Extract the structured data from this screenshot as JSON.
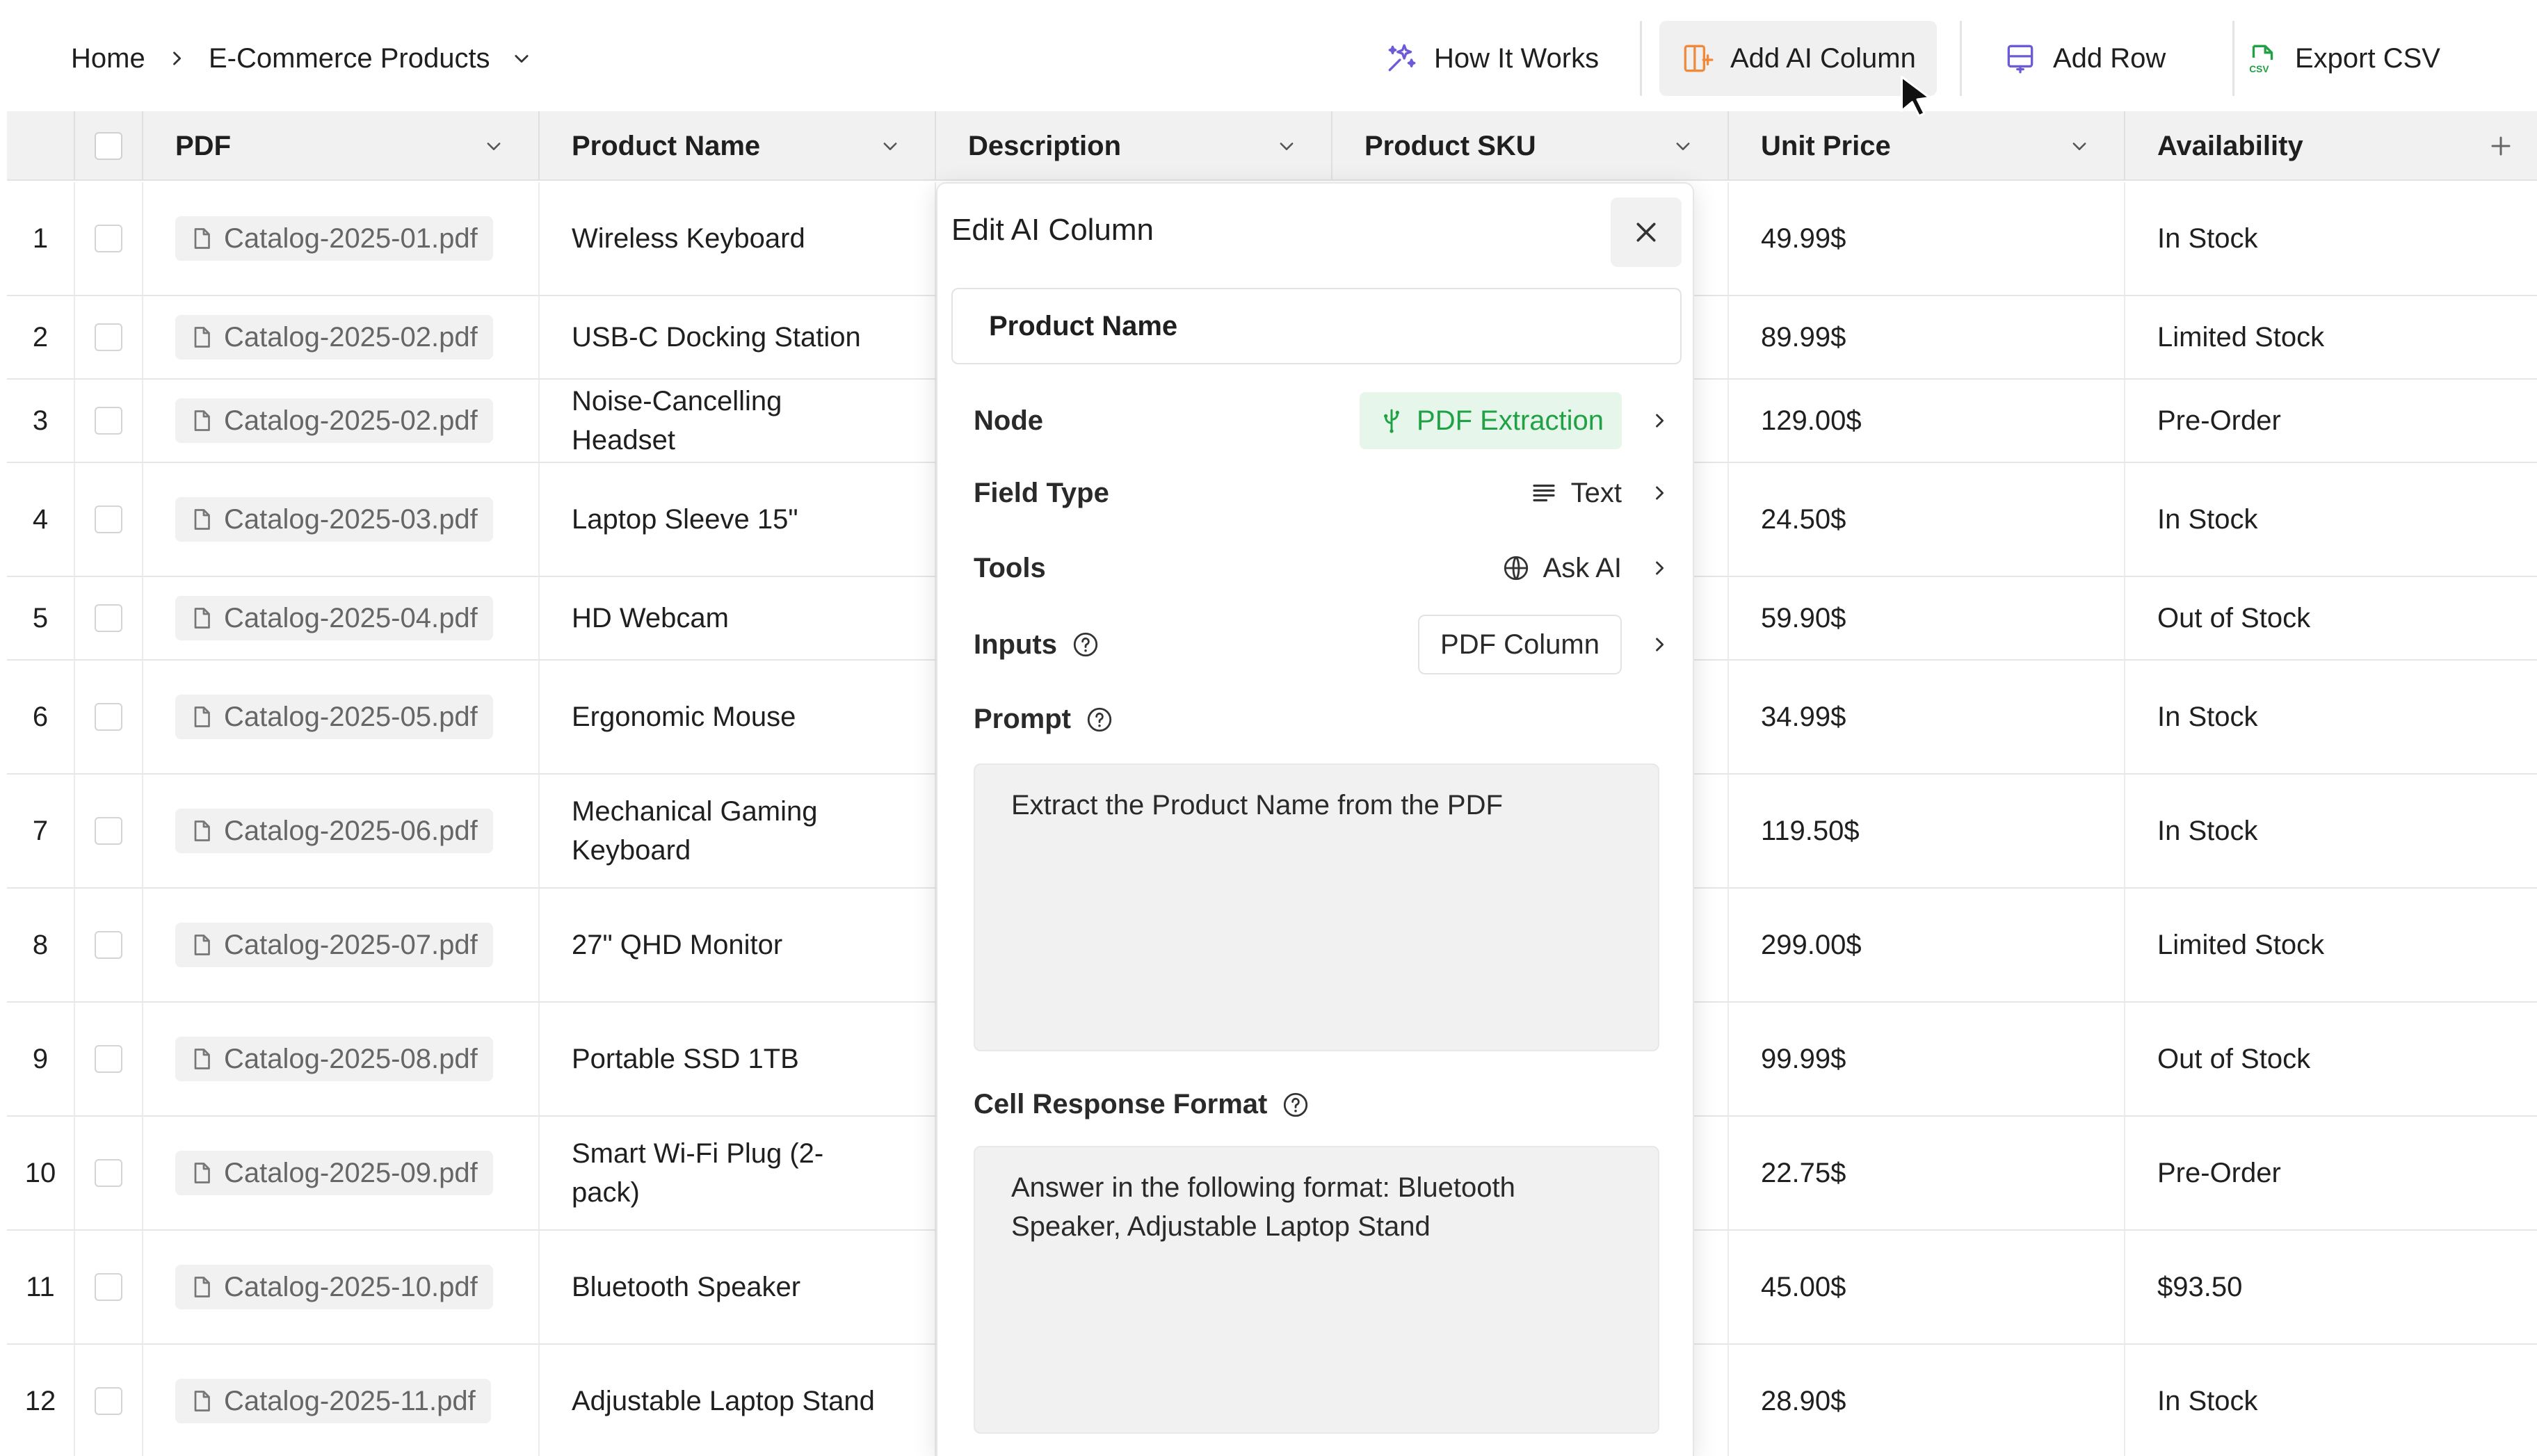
{
  "breadcrumb": {
    "home": "Home",
    "page": "E-Commerce Products"
  },
  "toolbar": {
    "how_it_works": "How It Works",
    "add_ai_column": "Add AI Column",
    "add_row": "Add Row",
    "export_csv": "Export CSV"
  },
  "colors": {
    "accent_green": "#21a146",
    "green_bg": "#e6f6ea",
    "purple_icon": "#6b5bd6",
    "orange_icon": "#ef8a3c",
    "header_bg": "#f1f1f1"
  },
  "table": {
    "columns": [
      "PDF",
      "Product Name",
      "Description",
      "Product SKU",
      "Unit Price",
      "Availability"
    ],
    "rows": [
      {
        "num": "1",
        "pdf": "Catalog-2025-01.pdf",
        "name": "Wireless Keyboard",
        "price": "49.99$",
        "availability": "In Stock"
      },
      {
        "num": "2",
        "pdf": "Catalog-2025-02.pdf",
        "name": "USB-C Docking Station",
        "price": "89.99$",
        "availability": "Limited Stock"
      },
      {
        "num": "3",
        "pdf": "Catalog-2025-02.pdf",
        "name": "Noise-Cancelling Headset",
        "price": "129.00$",
        "availability": "Pre-Order"
      },
      {
        "num": "4",
        "pdf": "Catalog-2025-03.pdf",
        "name": "Laptop Sleeve 15\"",
        "price": "24.50$",
        "availability": "In Stock"
      },
      {
        "num": "5",
        "pdf": "Catalog-2025-04.pdf",
        "name": "HD Webcam",
        "price": "59.90$",
        "availability": "Out of Stock"
      },
      {
        "num": "6",
        "pdf": "Catalog-2025-05.pdf",
        "name": "Ergonomic Mouse",
        "price": "34.99$",
        "availability": "In Stock"
      },
      {
        "num": "7",
        "pdf": "Catalog-2025-06.pdf",
        "name": "Mechanical Gaming Keyboard",
        "price": "119.50$",
        "availability": "In Stock"
      },
      {
        "num": "8",
        "pdf": "Catalog-2025-07.pdf",
        "name": "27\" QHD Monitor",
        "price": "299.00$",
        "availability": "Limited Stock"
      },
      {
        "num": "9",
        "pdf": "Catalog-2025-08.pdf",
        "name": "Portable SSD 1TB",
        "price": "99.99$",
        "availability": "Out of Stock"
      },
      {
        "num": "10",
        "pdf": "Catalog-2025-09.pdf",
        "name": "Smart Wi-Fi Plug (2-pack)",
        "price": "22.75$",
        "availability": "Pre-Order"
      },
      {
        "num": "11",
        "pdf": "Catalog-2025-10.pdf",
        "name": "Bluetooth Speaker",
        "price": "45.00$",
        "availability": "$93.50"
      },
      {
        "num": "12",
        "pdf": "Catalog-2025-11.pdf",
        "name": "Adjustable Laptop Stand",
        "price": "28.90$",
        "availability": "In Stock"
      }
    ]
  },
  "panel": {
    "title": "Edit AI Column",
    "column_name": "Product Name",
    "node_label": "Node",
    "node_value": "PDF Extraction",
    "field_type_label": "Field Type",
    "field_type_value": "Text",
    "tools_label": "Tools",
    "tools_value": "Ask AI",
    "inputs_label": "Inputs",
    "inputs_value": "PDF Column",
    "prompt_label": "Prompt",
    "prompt_text": "Extract the Product Name from the PDF",
    "format_label": "Cell Response Format",
    "format_text": "Answer in the following format: Bluetooth Speaker, Adjustable Laptop Stand"
  }
}
